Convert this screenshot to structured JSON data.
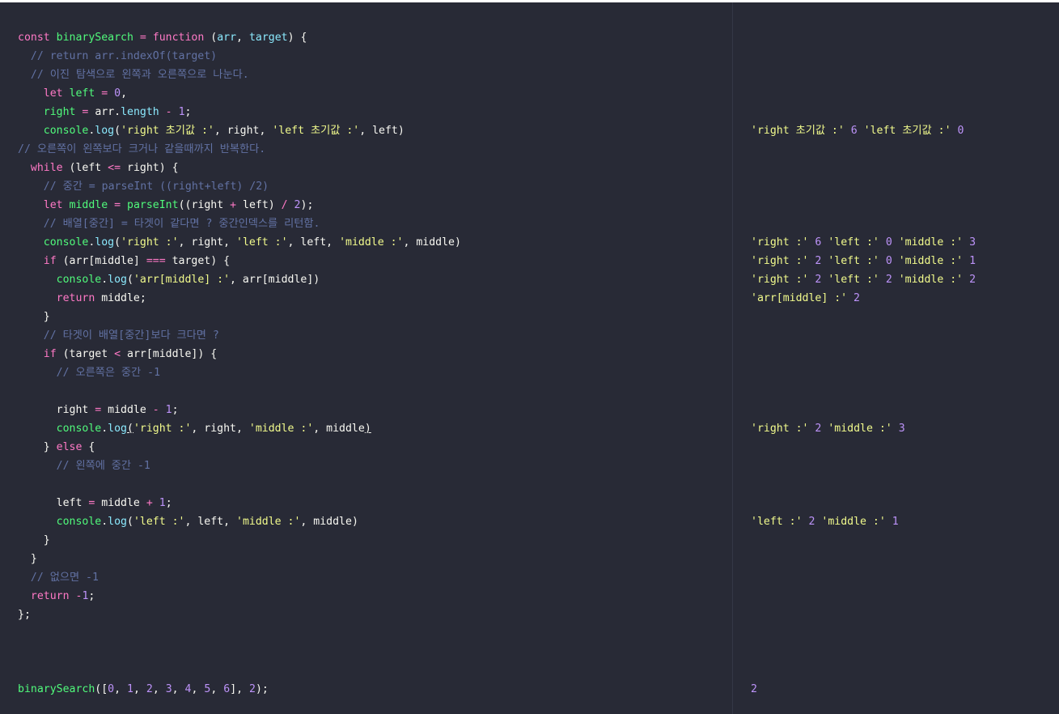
{
  "code_lines": [
    {
      "tokens": [
        [
          "kw",
          "const"
        ],
        [
          "pl",
          " "
        ],
        [
          "fn",
          "binarySearch"
        ],
        [
          "pl",
          " "
        ],
        [
          "op",
          "="
        ],
        [
          "pl",
          " "
        ],
        [
          "kw",
          "function"
        ],
        [
          "pl",
          " ("
        ],
        [
          "prop",
          "arr"
        ],
        [
          "pl",
          ", "
        ],
        [
          "prop",
          "target"
        ],
        [
          "pl",
          ") {"
        ]
      ]
    },
    {
      "tokens": [
        [
          "cm",
          "  // return arr.indexOf(target)"
        ]
      ]
    },
    {
      "tokens": [
        [
          "cm",
          "  // 이진 탐색으로 왼쪽과 오른쪽으로 나눈다."
        ]
      ]
    },
    {
      "tokens": [
        [
          "pl",
          "    "
        ],
        [
          "kw",
          "let"
        ],
        [
          "pl",
          " "
        ],
        [
          "fn",
          "left"
        ],
        [
          "pl",
          " "
        ],
        [
          "op",
          "="
        ],
        [
          "pl",
          " "
        ],
        [
          "num",
          "0"
        ],
        [
          "pl",
          ","
        ]
      ]
    },
    {
      "tokens": [
        [
          "pl",
          "    "
        ],
        [
          "fn",
          "right"
        ],
        [
          "pl",
          " "
        ],
        [
          "op",
          "="
        ],
        [
          "pl",
          " arr."
        ],
        [
          "prop",
          "length"
        ],
        [
          "pl",
          " "
        ],
        [
          "op",
          "-"
        ],
        [
          "pl",
          " "
        ],
        [
          "num",
          "1"
        ],
        [
          "pl",
          ";"
        ]
      ]
    },
    {
      "tokens": [
        [
          "pl",
          "    "
        ],
        [
          "fn",
          "console"
        ],
        [
          "pl",
          "."
        ],
        [
          "prop",
          "log"
        ],
        [
          "pl",
          "("
        ],
        [
          "str",
          "'right 초기값 :'"
        ],
        [
          "pl",
          ", right, "
        ],
        [
          "str",
          "'left 초기값 :'"
        ],
        [
          "pl",
          ", left)"
        ]
      ]
    },
    {
      "tokens": [
        [
          "cm",
          "// 오른쪽이 왼쪽보다 크거나 같을때까지 반복한다."
        ]
      ]
    },
    {
      "tokens": [
        [
          "pl",
          "  "
        ],
        [
          "kw",
          "while"
        ],
        [
          "pl",
          " (left "
        ],
        [
          "op",
          "<="
        ],
        [
          "pl",
          " right) {"
        ]
      ]
    },
    {
      "tokens": [
        [
          "cm",
          "    // 중간 = parseInt ((right+left) /2)"
        ]
      ]
    },
    {
      "tokens": [
        [
          "pl",
          "    "
        ],
        [
          "kw",
          "let"
        ],
        [
          "pl",
          " "
        ],
        [
          "fn",
          "middle"
        ],
        [
          "pl",
          " "
        ],
        [
          "op",
          "="
        ],
        [
          "pl",
          " "
        ],
        [
          "fn",
          "parseInt"
        ],
        [
          "pl",
          "((right "
        ],
        [
          "op",
          "+"
        ],
        [
          "pl",
          " left) "
        ],
        [
          "op",
          "/"
        ],
        [
          "pl",
          " "
        ],
        [
          "num",
          "2"
        ],
        [
          "pl",
          ");"
        ]
      ]
    },
    {
      "tokens": [
        [
          "cm",
          "    // 배열[중간] = 타겟이 같다면 ? 중간인덱스를 리턴함."
        ]
      ]
    },
    {
      "tokens": [
        [
          "pl",
          "    "
        ],
        [
          "fn",
          "console"
        ],
        [
          "pl",
          "."
        ],
        [
          "prop",
          "log"
        ],
        [
          "pl",
          "("
        ],
        [
          "str",
          "'right :'"
        ],
        [
          "pl",
          ", right, "
        ],
        [
          "str",
          "'left :'"
        ],
        [
          "pl",
          ", left, "
        ],
        [
          "str",
          "'middle :'"
        ],
        [
          "pl",
          ", middle)"
        ]
      ]
    },
    {
      "tokens": [
        [
          "pl",
          "    "
        ],
        [
          "kw",
          "if"
        ],
        [
          "pl",
          " (arr[middle] "
        ],
        [
          "op",
          "==="
        ],
        [
          "pl",
          " target) {"
        ]
      ]
    },
    {
      "tokens": [
        [
          "pl",
          "      "
        ],
        [
          "fn",
          "console"
        ],
        [
          "pl",
          "."
        ],
        [
          "prop",
          "log"
        ],
        [
          "pl",
          "("
        ],
        [
          "str",
          "'arr[middle] :'"
        ],
        [
          "pl",
          ", arr[middle])"
        ]
      ]
    },
    {
      "tokens": [
        [
          "pl",
          "      "
        ],
        [
          "kw",
          "return"
        ],
        [
          "pl",
          " middle;"
        ]
      ]
    },
    {
      "tokens": [
        [
          "pl",
          "    }"
        ]
      ]
    },
    {
      "tokens": [
        [
          "cm",
          "    // 타겟이 배열[중간]보다 크다면 ?"
        ]
      ]
    },
    {
      "tokens": [
        [
          "pl",
          "    "
        ],
        [
          "kw",
          "if"
        ],
        [
          "pl",
          " (target "
        ],
        [
          "op",
          "<"
        ],
        [
          "pl",
          " arr[middle]) {"
        ]
      ]
    },
    {
      "tokens": [
        [
          "cm",
          "      // 오른쪽은 중간 -1"
        ]
      ]
    },
    {
      "tokens": []
    },
    {
      "tokens": [
        [
          "pl",
          "      right "
        ],
        [
          "op",
          "="
        ],
        [
          "pl",
          " middle "
        ],
        [
          "op",
          "-"
        ],
        [
          "pl",
          " "
        ],
        [
          "num",
          "1"
        ],
        [
          "pl",
          ";"
        ]
      ]
    },
    {
      "tokens": [
        [
          "pl",
          "      "
        ],
        [
          "fn",
          "console"
        ],
        [
          "pl",
          "."
        ],
        [
          "prop",
          "log"
        ],
        [
          "pl ul",
          "("
        ],
        [
          "str",
          "'right :'"
        ],
        [
          "pl",
          ", right, "
        ],
        [
          "str",
          "'middle :'"
        ],
        [
          "pl",
          ", middle"
        ],
        [
          "pl ul",
          ")"
        ]
      ]
    },
    {
      "tokens": [
        [
          "pl",
          "    } "
        ],
        [
          "kw",
          "else"
        ],
        [
          "pl",
          " {"
        ]
      ]
    },
    {
      "tokens": [
        [
          "cm",
          "      // 왼쪽에 중간 -1"
        ]
      ]
    },
    {
      "tokens": []
    },
    {
      "tokens": [
        [
          "pl",
          "      left "
        ],
        [
          "op",
          "="
        ],
        [
          "pl",
          " middle "
        ],
        [
          "op",
          "+"
        ],
        [
          "pl",
          " "
        ],
        [
          "num",
          "1"
        ],
        [
          "pl",
          ";"
        ]
      ]
    },
    {
      "tokens": [
        [
          "pl",
          "      "
        ],
        [
          "fn",
          "console"
        ],
        [
          "pl",
          "."
        ],
        [
          "prop",
          "log"
        ],
        [
          "pl",
          "("
        ],
        [
          "str",
          "'left :'"
        ],
        [
          "pl",
          ", left, "
        ],
        [
          "str",
          "'middle :'"
        ],
        [
          "pl",
          ", middle)"
        ]
      ]
    },
    {
      "tokens": [
        [
          "pl",
          "    }"
        ]
      ]
    },
    {
      "tokens": [
        [
          "pl",
          "  }"
        ]
      ]
    },
    {
      "tokens": [
        [
          "cm",
          "  // 없으면 -1"
        ]
      ]
    },
    {
      "tokens": [
        [
          "pl",
          "  "
        ],
        [
          "kw",
          "return"
        ],
        [
          "pl",
          " "
        ],
        [
          "op",
          "-"
        ],
        [
          "num",
          "1"
        ],
        [
          "pl",
          ";"
        ]
      ]
    },
    {
      "tokens": [
        [
          "pl",
          "};"
        ]
      ]
    },
    {
      "tokens": []
    },
    {
      "tokens": []
    },
    {
      "tokens": []
    },
    {
      "tokens": [
        [
          "fn",
          "binarySearch"
        ],
        [
          "pl",
          "(["
        ],
        [
          "num",
          "0"
        ],
        [
          "pl",
          ", "
        ],
        [
          "num",
          "1"
        ],
        [
          "pl",
          ", "
        ],
        [
          "num",
          "2"
        ],
        [
          "pl",
          ", "
        ],
        [
          "num",
          "3"
        ],
        [
          "pl",
          ", "
        ],
        [
          "num",
          "4"
        ],
        [
          "pl",
          ", "
        ],
        [
          "num",
          "5"
        ],
        [
          "pl",
          ", "
        ],
        [
          "num",
          "6"
        ],
        [
          "pl",
          "], "
        ],
        [
          "num",
          "2"
        ],
        [
          "pl",
          ");"
        ]
      ]
    }
  ],
  "output_lines": [
    {
      "row": 5,
      "tokens": [
        [
          "str",
          "'right 초기값 :'"
        ],
        [
          "pl",
          " "
        ],
        [
          "num",
          "6"
        ],
        [
          "pl",
          " "
        ],
        [
          "str",
          "'left 초기값 :'"
        ],
        [
          "pl",
          " "
        ],
        [
          "num",
          "0"
        ]
      ]
    },
    {
      "row": 11,
      "tokens": [
        [
          "str",
          "'right :'"
        ],
        [
          "pl",
          " "
        ],
        [
          "num",
          "6"
        ],
        [
          "pl",
          " "
        ],
        [
          "str",
          "'left :'"
        ],
        [
          "pl",
          " "
        ],
        [
          "num",
          "0"
        ],
        [
          "pl",
          " "
        ],
        [
          "str",
          "'middle :'"
        ],
        [
          "pl",
          " "
        ],
        [
          "num",
          "3"
        ]
      ]
    },
    {
      "row": 12,
      "tokens": [
        [
          "str",
          "'right :'"
        ],
        [
          "pl",
          " "
        ],
        [
          "num",
          "2"
        ],
        [
          "pl",
          " "
        ],
        [
          "str",
          "'left :'"
        ],
        [
          "pl",
          " "
        ],
        [
          "num",
          "0"
        ],
        [
          "pl",
          " "
        ],
        [
          "str",
          "'middle :'"
        ],
        [
          "pl",
          " "
        ],
        [
          "num",
          "1"
        ]
      ]
    },
    {
      "row": 13,
      "tokens": [
        [
          "str",
          "'right :'"
        ],
        [
          "pl",
          " "
        ],
        [
          "num",
          "2"
        ],
        [
          "pl",
          " "
        ],
        [
          "str",
          "'left :'"
        ],
        [
          "pl",
          " "
        ],
        [
          "num",
          "2"
        ],
        [
          "pl",
          " "
        ],
        [
          "str",
          "'middle :'"
        ],
        [
          "pl",
          " "
        ],
        [
          "num",
          "2"
        ]
      ]
    },
    {
      "row": 14,
      "tokens": [
        [
          "str",
          "'arr[middle] :'"
        ],
        [
          "pl",
          " "
        ],
        [
          "num",
          "2"
        ]
      ]
    },
    {
      "row": 21,
      "tokens": [
        [
          "str",
          "'right :'"
        ],
        [
          "pl",
          " "
        ],
        [
          "num",
          "2"
        ],
        [
          "pl",
          " "
        ],
        [
          "str",
          "'middle :'"
        ],
        [
          "pl",
          " "
        ],
        [
          "num",
          "3"
        ]
      ]
    },
    {
      "row": 26,
      "tokens": [
        [
          "str",
          "'left :'"
        ],
        [
          "pl",
          " "
        ],
        [
          "num",
          "2"
        ],
        [
          "pl",
          " "
        ],
        [
          "str",
          "'middle :'"
        ],
        [
          "pl",
          " "
        ],
        [
          "num",
          "1"
        ]
      ]
    },
    {
      "row": 35,
      "tokens": [
        [
          "num",
          "2"
        ]
      ]
    }
  ],
  "colors": {
    "background": "#282a36",
    "keyword": "#ff79c6",
    "function": "#50fa7b",
    "string": "#f1fa8c",
    "number": "#bd93f9",
    "comment": "#6272a4",
    "property": "#8be9fd",
    "text": "#f8f8f2"
  }
}
